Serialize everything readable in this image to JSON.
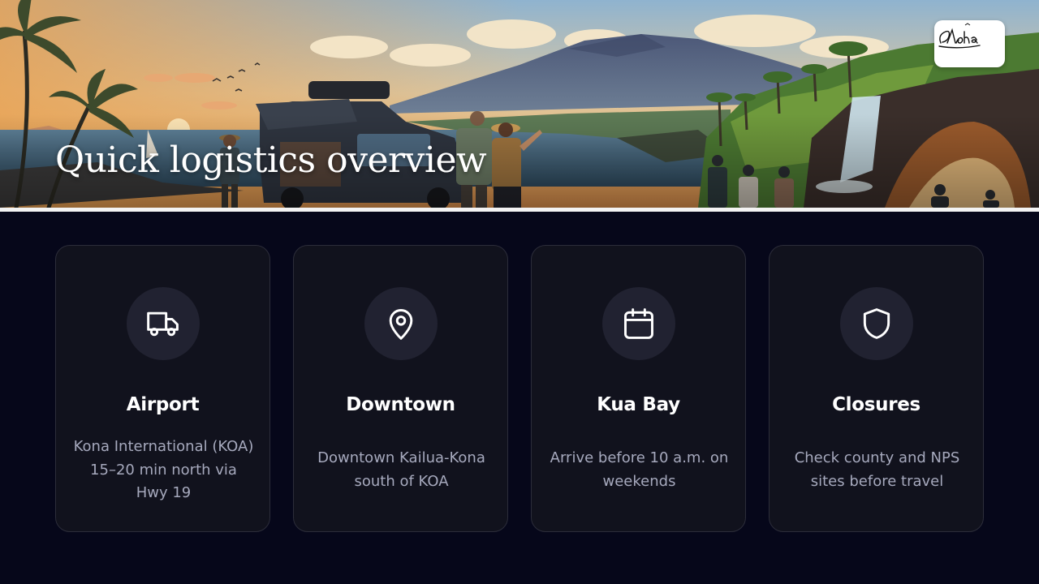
{
  "hero": {
    "title": "Quick logistics overview",
    "logo_text": "Aloha"
  },
  "cards": [
    {
      "icon": "truck-icon",
      "title": "Airport",
      "description": "Kona International (KOA) 15–20 min north via Hwy 19"
    },
    {
      "icon": "map-pin-icon",
      "title": "Downtown",
      "description": "Downtown Kailua-Kona south of KOA"
    },
    {
      "icon": "calendar-icon",
      "title": "Kua Bay",
      "description": "Arrive before 10 a.m. on weekends"
    },
    {
      "icon": "shield-icon",
      "title": "Closures",
      "description": "Check county and NPS sites before travel"
    }
  ],
  "colors": {
    "background": "#06071a",
    "card_background": "#11121d",
    "card_border": "#2c2d3a",
    "icon_circle": "#212231",
    "title_text": "#ffffff",
    "body_text": "#a6a9bd"
  }
}
